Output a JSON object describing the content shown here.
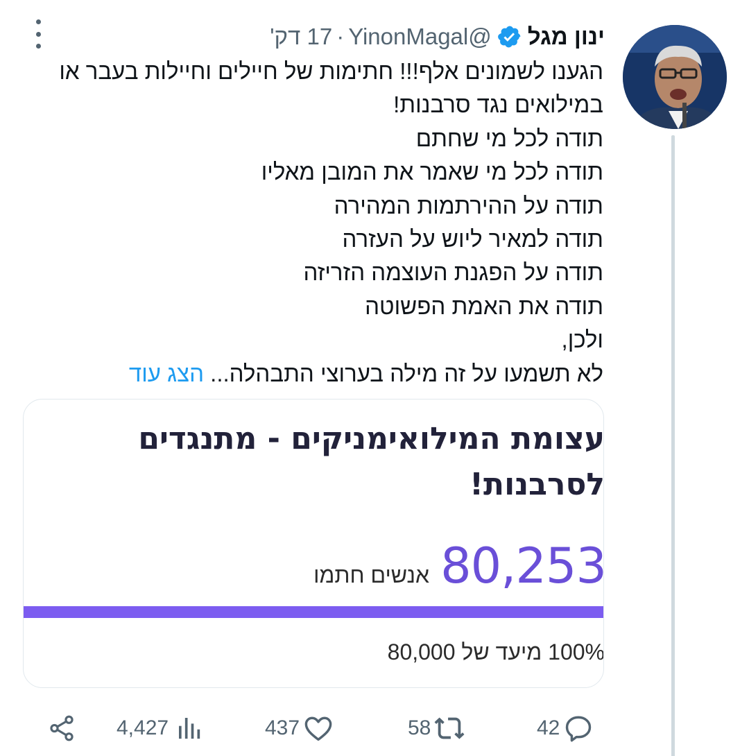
{
  "tweet": {
    "display_name": "ינון מגל",
    "handle": "@YinonMagal",
    "separator": "·",
    "time": "17 דק'",
    "text_lines": [
      "הגענו לשמונים אלף!!! חתימות של חיילים וחיילות בעבר או",
      "במילואים נגד סרבנות!",
      "תודה לכל מי שחתם",
      "תודה לכל מי שאמר את המובן מאליו",
      "תודה על ההירתמות המהירה",
      "תודה למאיר ליוש על העזרה",
      "תודה על הפגנת העוצמה הזריזה",
      "תודה את האמת הפשוטה",
      "ולכן,"
    ],
    "last_line": "לא תשמעו על זה מילה בערוצי התבהלה...",
    "show_more": "הצג עוד"
  },
  "card": {
    "title_lines": [
      "עצומת המילואימניקים - מתנגדים",
      "לסרבנות!"
    ],
    "count": "80,253",
    "count_label": "אנשים חתמו",
    "progress_fraction": 1.0,
    "goal_text": "100% מיעד של 80,000"
  },
  "actions": {
    "replies": "42",
    "retweets": "58",
    "likes": "437",
    "views": "4,427"
  },
  "colors": {
    "accent": "#1d9bf0",
    "muted": "#536471",
    "card_purple": "#7c5cf0",
    "count_purple": "#6a4fd8"
  },
  "icons": [
    "more-vertical-icon",
    "verified-badge-icon",
    "reply-icon",
    "retweet-icon",
    "like-icon",
    "views-icon",
    "share-icon"
  ]
}
